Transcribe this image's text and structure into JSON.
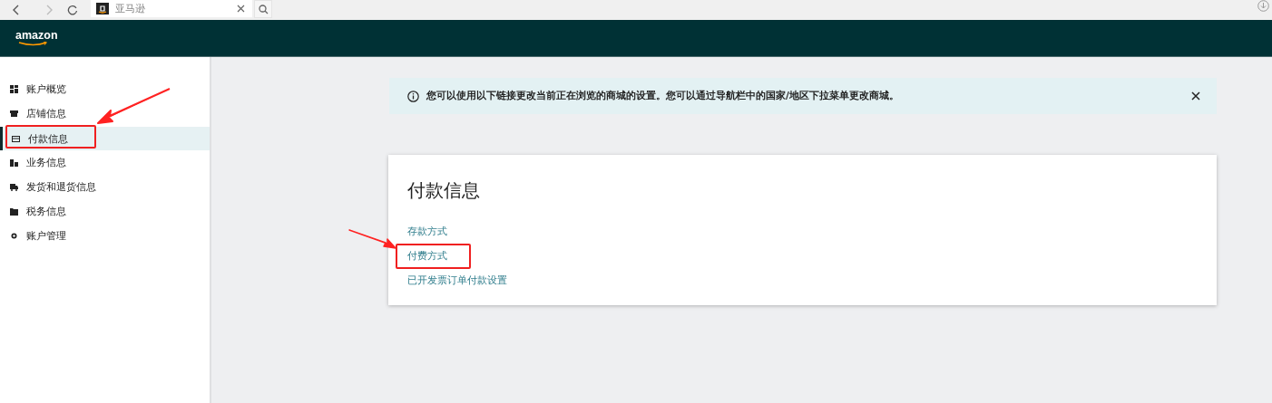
{
  "browser": {
    "tab_title": "亚马逊"
  },
  "header": {
    "logo": "amazon"
  },
  "sidebar": {
    "items": [
      {
        "label": "账户概览",
        "selected": false,
        "marked": false
      },
      {
        "label": "店铺信息",
        "selected": false,
        "marked": false
      },
      {
        "label": "付款信息",
        "selected": true,
        "marked": true
      },
      {
        "label": "业务信息",
        "selected": false,
        "marked": false
      },
      {
        "label": "发货和退货信息",
        "selected": false,
        "marked": false
      },
      {
        "label": "税务信息",
        "selected": false,
        "marked": false
      },
      {
        "label": "账户管理",
        "selected": false,
        "marked": false
      }
    ]
  },
  "banner": {
    "text": "您可以使用以下链接更改当前正在浏览的商城的设置。您可以通过导航栏中的国家/地区下拉菜单更改商城。"
  },
  "card": {
    "title": "付款信息",
    "links": [
      {
        "label": "存款方式",
        "marked": false
      },
      {
        "label": "付费方式",
        "marked": true
      },
      {
        "label": "已开发票订单付款设置",
        "marked": false
      }
    ]
  }
}
